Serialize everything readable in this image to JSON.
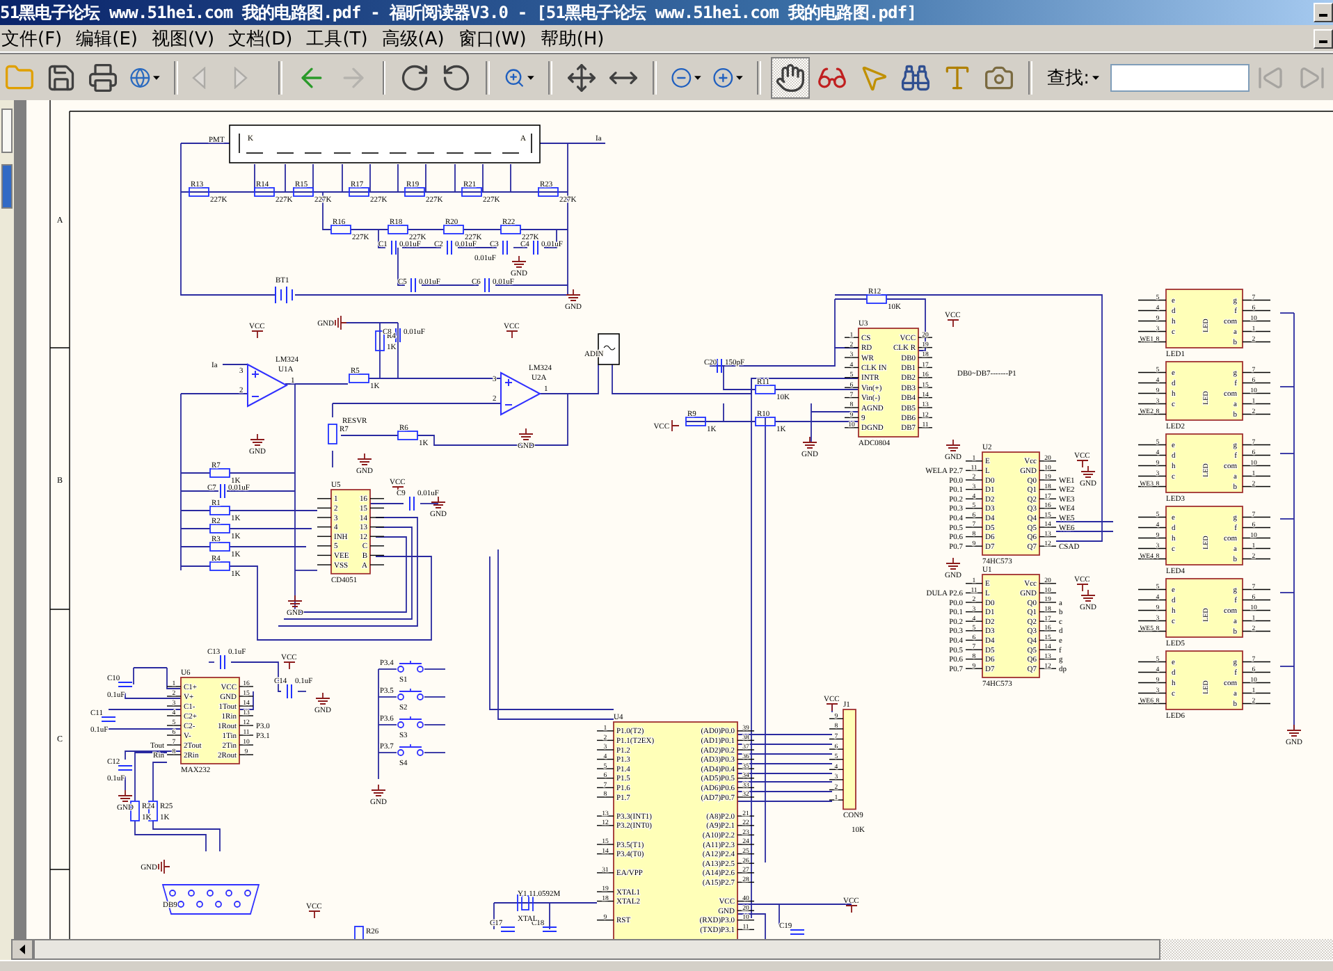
{
  "window": {
    "title": "51黑电子论坛 www.51hei.com 我的电路图.pdf - 福昕阅读器V3.0 - [51黑电子论坛 www.51hei.com 我的电路图.pdf]"
  },
  "menu": [
    "文件(F)",
    "编辑(E)",
    "视图(V)",
    "文档(D)",
    "工具(T)",
    "高级(A)",
    "窗口(W)",
    "帮助(H)"
  ],
  "toolbar": {
    "tools": [
      {
        "kind": "open",
        "selected": false,
        "disabled": false,
        "has_menu": false
      },
      {
        "kind": "save",
        "selected": false,
        "disabled": false,
        "has_menu": false
      },
      {
        "kind": "print",
        "selected": false,
        "disabled": false,
        "has_menu": false
      },
      {
        "kind": "email",
        "selected": false,
        "disabled": false,
        "has_menu": true
      },
      {
        "kind": "prev-page",
        "selected": false,
        "disabled": true,
        "has_menu": false
      },
      {
        "kind": "next-page",
        "selected": false,
        "disabled": true,
        "has_menu": false
      },
      {
        "kind": "back",
        "selected": false,
        "disabled": false,
        "has_menu": false
      },
      {
        "kind": "forward",
        "selected": false,
        "disabled": true,
        "has_menu": false
      },
      {
        "kind": "rotate-cw",
        "selected": false,
        "disabled": false,
        "has_menu": false
      },
      {
        "kind": "rotate-ccw",
        "selected": false,
        "disabled": false,
        "has_menu": false
      },
      {
        "kind": "zoom",
        "selected": false,
        "disabled": false,
        "has_menu": true
      },
      {
        "kind": "fit-page",
        "selected": false,
        "disabled": false,
        "has_menu": false
      },
      {
        "kind": "fit-width",
        "selected": false,
        "disabled": false,
        "has_menu": false
      },
      {
        "kind": "zoom-out",
        "selected": false,
        "disabled": false,
        "has_menu": true
      },
      {
        "kind": "zoom-in",
        "selected": false,
        "disabled": false,
        "has_menu": true
      },
      {
        "kind": "hand",
        "selected": true,
        "disabled": false,
        "has_menu": false
      },
      {
        "kind": "reader",
        "selected": false,
        "disabled": false,
        "has_menu": false
      },
      {
        "kind": "select",
        "selected": false,
        "disabled": false,
        "has_menu": false
      },
      {
        "kind": "find",
        "selected": false,
        "disabled": false,
        "has_menu": false
      },
      {
        "kind": "text-select",
        "selected": false,
        "disabled": false,
        "has_menu": false
      },
      {
        "kind": "snapshot",
        "selected": false,
        "disabled": false,
        "has_menu": false
      }
    ],
    "find_label": "查找:",
    "find_buttons": [
      {
        "kind": "find-prev",
        "disabled": true
      },
      {
        "kind": "find-next",
        "disabled": true
      }
    ]
  },
  "schematic": {
    "zones": [
      "A",
      "B",
      "C"
    ],
    "pmt": {
      "label": "PMT",
      "k": "K",
      "a": "A",
      "output": "Ia"
    },
    "battery": "BT1",
    "resistors": [
      {
        "ref": "R13",
        "value": "227K"
      },
      {
        "ref": "R14",
        "value": "227K"
      },
      {
        "ref": "R15",
        "value": "227K"
      },
      {
        "ref": "R17",
        "value": "227K"
      },
      {
        "ref": "R19",
        "value": "227K"
      },
      {
        "ref": "R21",
        "value": "227K"
      },
      {
        "ref": "R23",
        "value": "227K"
      },
      {
        "ref": "R16",
        "value": "227K"
      },
      {
        "ref": "R18",
        "value": "227K"
      },
      {
        "ref": "R20",
        "value": "227K"
      },
      {
        "ref": "R22",
        "value": "227K"
      },
      {
        "ref": "R4",
        "value": "1K"
      },
      {
        "ref": "R5",
        "value": "1K"
      },
      {
        "ref": "R7"
      },
      {
        "ref": "R6",
        "value": "1K"
      },
      {
        "ref": "R7",
        "value": "1K"
      },
      {
        "ref": "R1",
        "value": "1K"
      },
      {
        "ref": "R2",
        "value": "1K"
      },
      {
        "ref": "R3",
        "value": "1K"
      },
      {
        "ref": "R4",
        "value": "1K"
      },
      {
        "ref": "R12",
        "value": "10K"
      },
      {
        "ref": "R11",
        "value": "10K"
      },
      {
        "ref": "R9",
        "value": "1K"
      },
      {
        "ref": "R10",
        "value": "1K"
      },
      {
        "ref": "R24",
        "value": "1K"
      },
      {
        "ref": "R25",
        "value": "1K"
      },
      {
        "ref": "R26"
      }
    ],
    "capacitors": [
      {
        "ref": "C1",
        "value": "0.01uF"
      },
      {
        "ref": "C2",
        "value": "0.01uF"
      },
      {
        "ref": "C3",
        "value": "0.01uF"
      },
      {
        "ref": "C4",
        "value": "0.01uF"
      },
      {
        "ref": "C5",
        "value": "0.01uF"
      },
      {
        "ref": "C6",
        "value": "0.01uF"
      },
      {
        "ref": "C8",
        "value": "0.01uF"
      },
      {
        "ref": "C7",
        "value": "0.01uF"
      },
      {
        "ref": "C9",
        "value": "0.01uF"
      },
      {
        "ref": "C20",
        "value": "150pF"
      },
      {
        "ref": "C13",
        "value": "0.1uF"
      },
      {
        "ref": "C14",
        "value": "0.1uF"
      },
      {
        "ref": "C10",
        "value": "0.1uF"
      },
      {
        "ref": "C11",
        "value": "0.1uF"
      },
      {
        "ref": "C12",
        "value": "0.1uF"
      },
      {
        "ref": "C17"
      },
      {
        "ref": "C18"
      },
      {
        "ref": "C19"
      }
    ],
    "nets": [
      {
        "kind": "gnd",
        "text": "GND"
      },
      {
        "kind": "gnd",
        "text": "GND"
      },
      {
        "kind": "gnd-left",
        "text": "GND"
      },
      {
        "kind": "vcc",
        "text": "VCC"
      },
      {
        "kind": "gnd",
        "text": "GND"
      },
      {
        "kind": "vcc",
        "text": "VCC"
      },
      {
        "kind": "gnd",
        "text": "GND"
      },
      {
        "kind": "gnd",
        "text": "GND"
      },
      {
        "kind": "vcc",
        "text": "VCC"
      },
      {
        "kind": "gnd",
        "text": "GND"
      },
      {
        "kind": "gnd",
        "text": "GND"
      },
      {
        "kind": "vcc",
        "text": "VCC"
      },
      {
        "kind": "vcc-left",
        "text": "VCC"
      },
      {
        "kind": "gnd",
        "text": "GND"
      },
      {
        "kind": "gnd",
        "text": "GND"
      },
      {
        "kind": "vcc",
        "text": "VCC"
      },
      {
        "kind": "gnd",
        "text": "GND"
      },
      {
        "kind": "gnd",
        "text": "GND"
      },
      {
        "kind": "vcc",
        "text": "VCC"
      },
      {
        "kind": "gnd",
        "text": "GND"
      },
      {
        "kind": "gnd",
        "text": "GND"
      },
      {
        "kind": "vcc",
        "text": "VCC"
      },
      {
        "kind": "gnd",
        "text": "GND"
      },
      {
        "kind": "gnd",
        "text": "GND"
      },
      {
        "kind": "gnd",
        "text": "GND"
      },
      {
        "kind": "gnd-left",
        "text": "GND"
      },
      {
        "kind": "vcc",
        "text": "VCC"
      },
      {
        "kind": "vcc",
        "text": "VCC"
      },
      {
        "kind": "vcc",
        "text": "VCC"
      }
    ],
    "labels": [
      "Ia",
      "ADIN",
      "RESVR",
      "DB0~DB7-------P1",
      "DB9",
      "Y1 11.0592M",
      "XTAL",
      "10K"
    ],
    "opamps": [
      {
        "ref": "U1A",
        "part": "LM324",
        "pins": [
          "3",
          "2",
          "1"
        ]
      },
      {
        "ref": "U2A",
        "part": "LM324",
        "pins": [
          "3",
          "2",
          "1"
        ]
      }
    ],
    "chips": [
      {
        "ref": "U5",
        "part": "CD4051",
        "left": [
          {
            "s": "1"
          },
          {
            "s": "2"
          },
          {
            "s": "3"
          },
          {
            "s": "4"
          },
          {
            "s": "INH"
          },
          {
            "s": "5"
          },
          {
            "s": "VEE"
          },
          {
            "s": "VSS"
          }
        ],
        "right": [
          {
            "s": "16"
          },
          {
            "s": "15"
          },
          {
            "s": "14"
          },
          {
            "s": "13"
          },
          {
            "s": "12"
          },
          {
            "s": "C"
          },
          {
            "s": "B"
          },
          {
            "s": "A"
          }
        ]
      },
      {
        "ref": "U3",
        "part": "ADC0804",
        "left": [
          {
            "n": "1",
            "s": "CS"
          },
          {
            "n": "2",
            "s": "RD"
          },
          {
            "n": "3",
            "s": "WR"
          },
          {
            "n": "4",
            "s": "CLK IN"
          },
          {
            "n": "5",
            "s": "INTR"
          },
          {
            "n": "6",
            "s": "Vin(+)"
          },
          {
            "n": "7",
            "s": "Vin(-)"
          },
          {
            "n": "8",
            "s": "AGND"
          },
          {
            "n": "9",
            "s": "9"
          },
          {
            "n": "10",
            "s": "DGND"
          }
        ],
        "right": [
          {
            "n": "20",
            "s": "VCC"
          },
          {
            "n": "19",
            "s": "CLK R"
          },
          {
            "n": "18",
            "s": "DB0"
          },
          {
            "n": "17",
            "s": "DB1"
          },
          {
            "n": "16",
            "s": "DB2"
          },
          {
            "n": "15",
            "s": "DB3"
          },
          {
            "n": "14",
            "s": "DB4"
          },
          {
            "n": "13",
            "s": "DB5"
          },
          {
            "n": "12",
            "s": "DB6"
          },
          {
            "n": "11",
            "s": "DB7"
          }
        ]
      },
      {
        "ref": "U2",
        "part": "74HC573",
        "left": [
          {
            "n": "1",
            "s": "E"
          },
          {
            "n": "11",
            "s": "L",
            "net": "WELA P2.7"
          },
          {
            "n": "2",
            "s": "D0",
            "net": "P0.0"
          },
          {
            "n": "3",
            "s": "D1",
            "net": "P0.1"
          },
          {
            "n": "4",
            "s": "D2",
            "net": "P0.2"
          },
          {
            "n": "5",
            "s": "D3",
            "net": "P0.3"
          },
          {
            "n": "6",
            "s": "D4",
            "net": "P0.4"
          },
          {
            "n": "7",
            "s": "D5",
            "net": "P0.5"
          },
          {
            "n": "8",
            "s": "D6",
            "net": "P0.6"
          },
          {
            "n": "9",
            "s": "D7",
            "net": "P0.7"
          }
        ],
        "right": [
          {
            "n": "20",
            "s": "Vcc"
          },
          {
            "n": "10",
            "s": "GND"
          },
          {
            "n": "19",
            "s": "Q0",
            "net": "WE1"
          },
          {
            "n": "18",
            "s": "Q1",
            "net": "WE2"
          },
          {
            "n": "17",
            "s": "Q2",
            "net": "WE3"
          },
          {
            "n": "16",
            "s": "Q3",
            "net": "WE4"
          },
          {
            "n": "15",
            "s": "Q4",
            "net": "WE5"
          },
          {
            "n": "14",
            "s": "Q5",
            "net": "WE6"
          },
          {
            "n": "13",
            "s": "Q6"
          },
          {
            "n": "12",
            "s": "Q7",
            "net": "CSAD"
          }
        ]
      },
      {
        "ref": "U1",
        "part": "74HC573",
        "left": [
          {
            "n": "1",
            "s": "E"
          },
          {
            "n": "11",
            "s": "L",
            "net": "DULA P2.6"
          },
          {
            "n": "2",
            "s": "D0",
            "net": "P0.0"
          },
          {
            "n": "3",
            "s": "D1",
            "net": "P0.1"
          },
          {
            "n": "4",
            "s": "D2",
            "net": "P0.2"
          },
          {
            "n": "5",
            "s": "D3",
            "net": "P0.3"
          },
          {
            "n": "6",
            "s": "D4",
            "net": "P0.4"
          },
          {
            "n": "7",
            "s": "D5",
            "net": "P0.5"
          },
          {
            "n": "8",
            "s": "D6",
            "net": "P0.6"
          },
          {
            "n": "9",
            "s": "D7",
            "net": "P0.7"
          }
        ],
        "right": [
          {
            "n": "20",
            "s": "Vcc"
          },
          {
            "n": "10",
            "s": "GND"
          },
          {
            "n": "19",
            "s": "Q0",
            "net": "a"
          },
          {
            "n": "18",
            "s": "Q1",
            "net": "b"
          },
          {
            "n": "17",
            "s": "Q2",
            "net": "c"
          },
          {
            "n": "16",
            "s": "Q3",
            "net": "d"
          },
          {
            "n": "15",
            "s": "Q4",
            "net": "e"
          },
          {
            "n": "14",
            "s": "Q5",
            "net": "f"
          },
          {
            "n": "13",
            "s": "Q6",
            "net": "g"
          },
          {
            "n": "12",
            "s": "Q7",
            "net": "dp"
          }
        ]
      },
      {
        "ref": "U6",
        "part": "MAX232",
        "left": [
          {
            "n": "1",
            "s": "C1+"
          },
          {
            "n": "2",
            "s": "V+"
          },
          {
            "n": "3",
            "s": "C1-"
          },
          {
            "n": "4",
            "s": "C2+"
          },
          {
            "n": "5",
            "s": "C2-"
          },
          {
            "n": "6",
            "s": "V-"
          },
          {
            "n": "7",
            "s": "2Tout",
            "net": "Tout"
          },
          {
            "n": "8",
            "s": "2Rin",
            "net": "Rin"
          }
        ],
        "right": [
          {
            "n": "16",
            "s": "VCC"
          },
          {
            "n": "15",
            "s": "GND"
          },
          {
            "n": "14",
            "s": "1Tout"
          },
          {
            "n": "13",
            "s": "1Rin"
          },
          {
            "n": "12",
            "s": "1Rout",
            "net": "P3.0"
          },
          {
            "n": "11",
            "s": "1Tin",
            "net": "P3.1"
          },
          {
            "n": "10",
            "s": "2Tin"
          },
          {
            "n": "9",
            "s": "2Rout"
          }
        ]
      },
      {
        "ref": "U4",
        "left": [
          {
            "n": "1",
            "s": "P1.0(T2)"
          },
          {
            "n": "2",
            "s": "P1.1(T2EX)"
          },
          {
            "n": "3",
            "s": "P1.2"
          },
          {
            "n": "4",
            "s": "P1.3"
          },
          {
            "n": "5",
            "s": "P1.4"
          },
          {
            "n": "6",
            "s": "P1.5"
          },
          {
            "n": "7",
            "s": "P1.6"
          },
          {
            "n": "8",
            "s": "P1.7"
          },
          {
            "n": "13",
            "s": "P3.3(INT1)"
          },
          {
            "n": "12",
            "s": "P3.2(INT0)"
          },
          {
            "n": "15",
            "s": "P3.5(T1)"
          },
          {
            "n": "14",
            "s": "P3.4(T0)"
          },
          {
            "n": "31",
            "s": "EA/VPP"
          },
          {
            "n": "19",
            "s": "XTAL1"
          },
          {
            "n": "18",
            "s": "XTAL2"
          },
          {
            "n": "9",
            "s": "RST"
          }
        ],
        "right": [
          {
            "n": "39",
            "s": "(AD0)P0.0"
          },
          {
            "n": "38",
            "s": "(AD1)P0.1"
          },
          {
            "n": "37",
            "s": "(AD2)P0.2"
          },
          {
            "n": "36",
            "s": "(AD3)P0.3"
          },
          {
            "n": "35",
            "s": "(AD4)P0.4"
          },
          {
            "n": "34",
            "s": "(AD5)P0.5"
          },
          {
            "n": "33",
            "s": "(AD6)P0.6"
          },
          {
            "n": "32",
            "s": "(AD7)P0.7"
          },
          {
            "n": "21",
            "s": "(A8)P2.0"
          },
          {
            "n": "22",
            "s": "(A9)P2.1"
          },
          {
            "n": "23",
            "s": "(A10)P2.2"
          },
          {
            "n": "24",
            "s": "(A11)P2.3"
          },
          {
            "n": "25",
            "s": "(A12)P2.4"
          },
          {
            "n": "26",
            "s": "(A13)P2.5"
          },
          {
            "n": "27",
            "s": "(A14)P2.6"
          },
          {
            "n": "28",
            "s": "(A15)P2.7"
          },
          {
            "n": "40",
            "s": "VCC"
          },
          {
            "n": "20",
            "s": "GND"
          },
          {
            "n": "10",
            "s": "(RXD)P3.0"
          },
          {
            "n": "11",
            "s": "(TXD)P3.1"
          }
        ]
      },
      {
        "ref": "J1",
        "part": "CON9",
        "left": [
          {
            "n": "9"
          },
          {
            "n": "8"
          },
          {
            "n": "7"
          },
          {
            "n": "6"
          },
          {
            "n": "5"
          },
          {
            "n": "4"
          },
          {
            "n": "3"
          },
          {
            "n": "2"
          },
          {
            "n": "1"
          }
        ]
      }
    ],
    "displays": [
      {
        "ref": "LED1",
        "center": "LED",
        "net": "WE1",
        "left": [
          {
            "n": "5",
            "s": "e"
          },
          {
            "n": "4",
            "s": "d"
          },
          {
            "n": "9",
            "s": "h"
          },
          {
            "n": "3",
            "s": "c"
          },
          {
            "n": "8"
          }
        ],
        "right": [
          {
            "n": "7",
            "s": "g"
          },
          {
            "n": "6",
            "s": "f"
          },
          {
            "n": "10",
            "s": "com"
          },
          {
            "n": "1",
            "s": "a"
          },
          {
            "n": "2",
            "s": "b"
          }
        ]
      },
      {
        "ref": "LED2",
        "center": "LED",
        "net": "WE2",
        "left": [
          {
            "n": "5",
            "s": "e"
          },
          {
            "n": "4",
            "s": "d"
          },
          {
            "n": "9",
            "s": "h"
          },
          {
            "n": "3",
            "s": "c"
          },
          {
            "n": "8"
          }
        ],
        "right": [
          {
            "n": "7",
            "s": "g"
          },
          {
            "n": "6",
            "s": "f"
          },
          {
            "n": "10",
            "s": "com"
          },
          {
            "n": "1",
            "s": "a"
          },
          {
            "n": "2",
            "s": "b"
          }
        ]
      },
      {
        "ref": "LED3",
        "center": "LED",
        "net": "WE3",
        "left": [
          {
            "n": "5",
            "s": "e"
          },
          {
            "n": "4",
            "s": "d"
          },
          {
            "n": "9",
            "s": "h"
          },
          {
            "n": "3",
            "s": "c"
          },
          {
            "n": "8"
          }
        ],
        "right": [
          {
            "n": "7",
            "s": "g"
          },
          {
            "n": "6",
            "s": "f"
          },
          {
            "n": "10",
            "s": "com"
          },
          {
            "n": "1",
            "s": "a"
          },
          {
            "n": "2",
            "s": "b"
          }
        ]
      },
      {
        "ref": "LED4",
        "center": "LED",
        "net": "WE4",
        "left": [
          {
            "n": "5",
            "s": "e"
          },
          {
            "n": "4",
            "s": "d"
          },
          {
            "n": "9",
            "s": "h"
          },
          {
            "n": "3",
            "s": "c"
          },
          {
            "n": "8"
          }
        ],
        "right": [
          {
            "n": "7",
            "s": "g"
          },
          {
            "n": "6",
            "s": "f"
          },
          {
            "n": "10",
            "s": "com"
          },
          {
            "n": "1",
            "s": "a"
          },
          {
            "n": "2",
            "s": "b"
          }
        ]
      },
      {
        "ref": "LED5",
        "center": "LED",
        "net": "WE5",
        "left": [
          {
            "n": "5",
            "s": "e"
          },
          {
            "n": "4",
            "s": "d"
          },
          {
            "n": "9",
            "s": "h"
          },
          {
            "n": "3",
            "s": "c"
          },
          {
            "n": "8"
          }
        ],
        "right": [
          {
            "n": "7",
            "s": "g"
          },
          {
            "n": "6",
            "s": "f"
          },
          {
            "n": "10",
            "s": "com"
          },
          {
            "n": "1",
            "s": "a"
          },
          {
            "n": "2",
            "s": "b"
          }
        ]
      },
      {
        "ref": "LED6",
        "center": "LED",
        "net": "WE6",
        "left": [
          {
            "n": "5",
            "s": "e"
          },
          {
            "n": "4",
            "s": "d"
          },
          {
            "n": "9",
            "s": "h"
          },
          {
            "n": "3",
            "s": "c"
          },
          {
            "n": "8"
          }
        ],
        "right": [
          {
            "n": "7",
            "s": "g"
          },
          {
            "n": "6",
            "s": "f"
          },
          {
            "n": "10",
            "s": "com"
          },
          {
            "n": "1",
            "s": "a"
          },
          {
            "n": "2",
            "s": "b"
          }
        ]
      }
    ],
    "switches": [
      {
        "ref": "S1",
        "net": "P3.4"
      },
      {
        "ref": "S2",
        "net": "P3.5"
      },
      {
        "ref": "S3",
        "net": "P3.6"
      },
      {
        "ref": "S4",
        "net": "P3.7"
      }
    ]
  }
}
